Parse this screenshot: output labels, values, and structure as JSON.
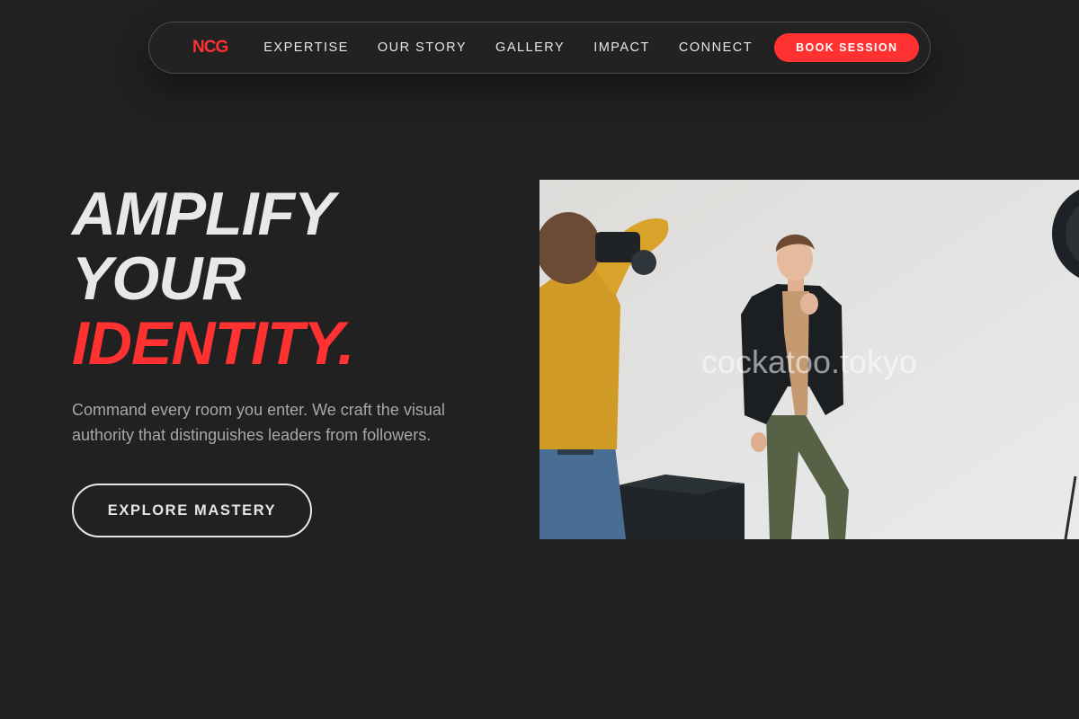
{
  "nav": {
    "logo": "NCG",
    "links": [
      "EXPERTISE",
      "OUR STORY",
      "GALLERY",
      "IMPACT",
      "CONNECT"
    ],
    "cta": "BOOK SESSION"
  },
  "hero": {
    "title_line1": "AMPLIFY",
    "title_line2": "YOUR",
    "title_line3": "IDENTITY.",
    "subtitle": "Command every room you enter. We craft the visual authority that distinguishes leaders from followers.",
    "cta": "EXPLORE MASTERY",
    "image_watermark": "cockatoo.tokyo"
  },
  "colors": {
    "background": "#212121",
    "accent": "#ff3131",
    "text": "#e8e8e8",
    "muted": "#a8a8a8"
  }
}
